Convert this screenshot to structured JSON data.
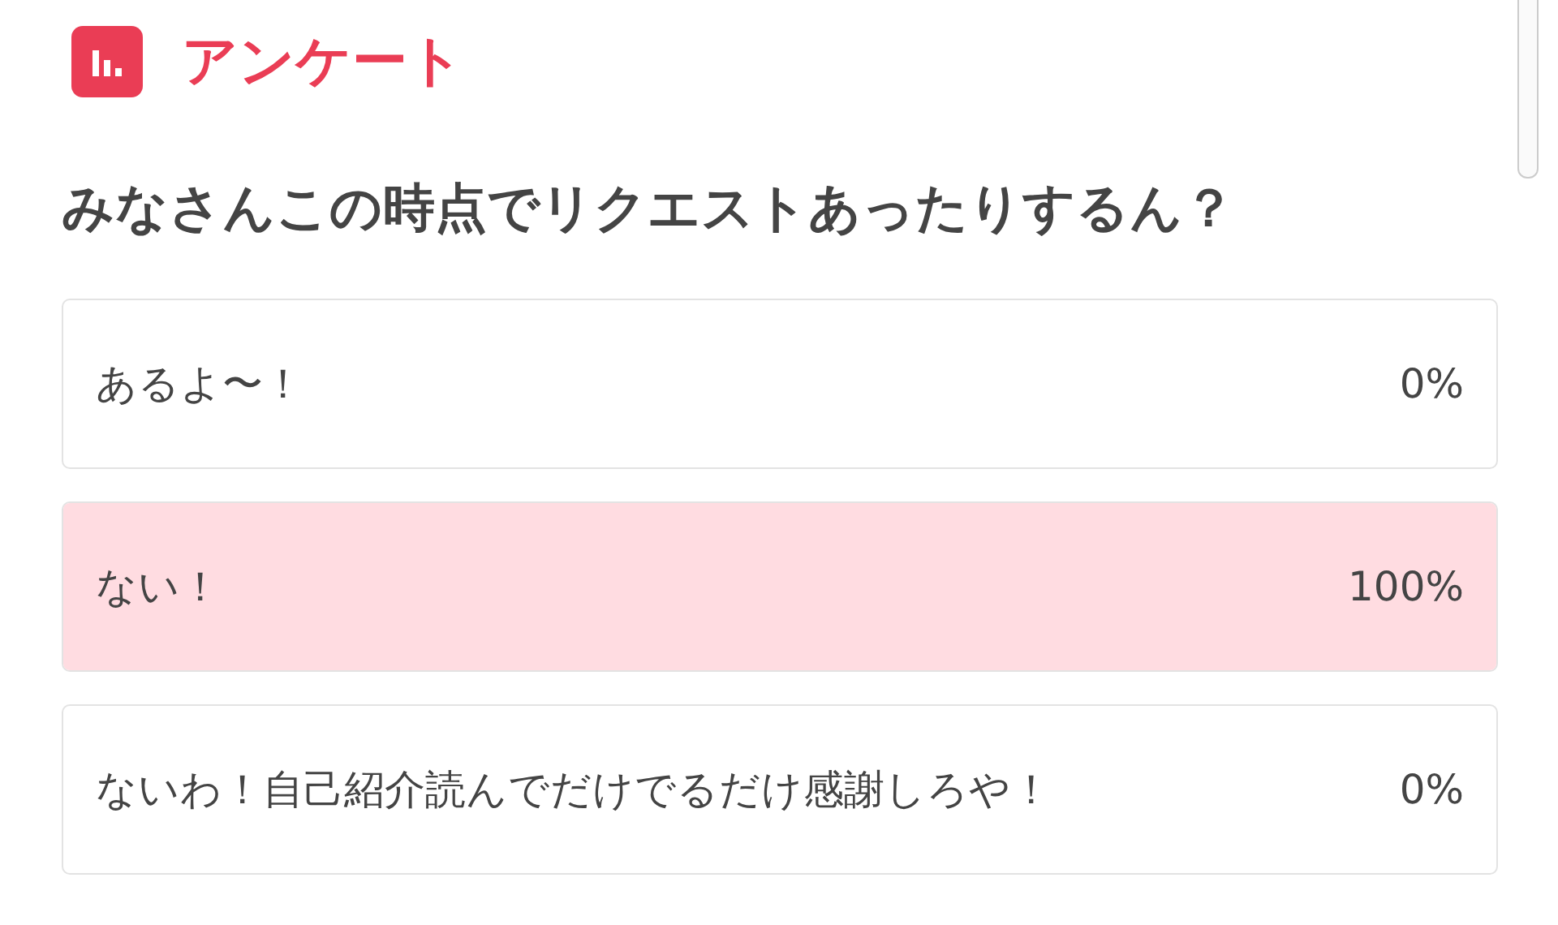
{
  "header": {
    "title": "アンケート"
  },
  "question": "みなさんこの時点でリクエストあったりするん？",
  "options": [
    {
      "label": "あるよ〜！",
      "percent": "0%",
      "level": 0
    },
    {
      "label": "ない！",
      "percent": "100%",
      "level": 1
    },
    {
      "label": "ないわ！自己紹介読んでだけでるだけ感謝しろや！",
      "percent": "0%",
      "level": 0
    }
  ]
}
